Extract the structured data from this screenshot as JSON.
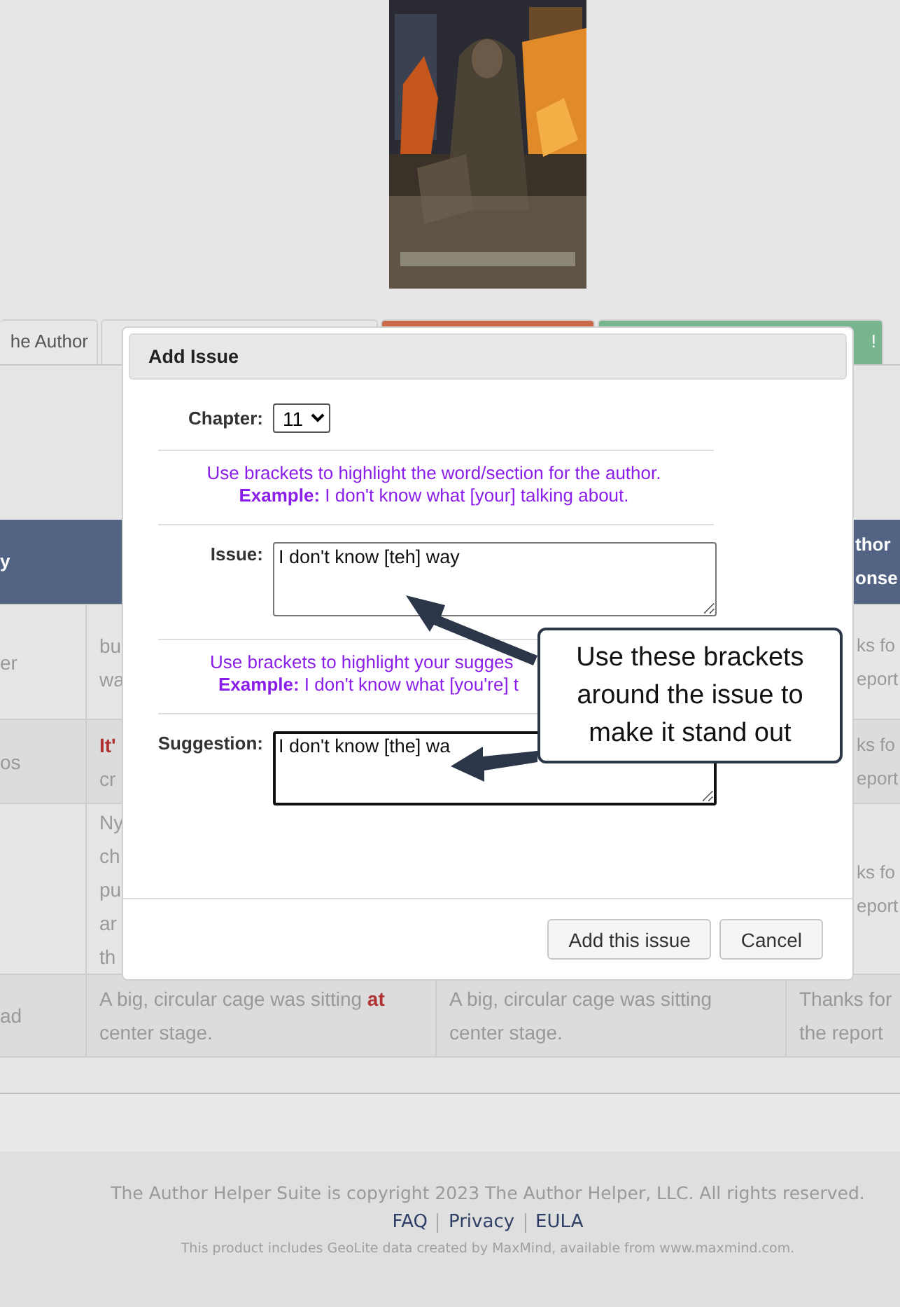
{
  "tabs": [
    {
      "label": "he Author",
      "color": "#e8e8e8"
    },
    {
      "color": "#e8e8e8"
    },
    {
      "color": "#c8694a"
    },
    {
      "label": "!",
      "color": "#76b58d"
    }
  ],
  "table": {
    "columns": [
      {
        "label": "y"
      },
      {},
      {},
      {
        "label": "thor onse"
      }
    ],
    "rows": [
      {
        "cells": [
          [
            "er"
          ],
          [
            "bu",
            "wa"
          ],
          [],
          [
            "ks fo",
            "eport"
          ]
        ]
      },
      {
        "cells": [
          [
            "os"
          ],
          [
            "**It'**",
            "cr"
          ],
          [],
          [
            "ks fo",
            "eport"
          ]
        ]
      },
      {
        "cells": [
          [],
          [
            "Ny",
            "ch",
            "pu",
            "ar",
            "th"
          ],
          [],
          [
            "ks fo",
            "eport"
          ]
        ]
      },
      {
        "cells": [
          [
            "ad"
          ],
          [
            "A big, circular cage was sitting **at** center stage."
          ],
          [
            "A big, circular cage was sitting center stage."
          ],
          [
            "Thanks for",
            "the report"
          ]
        ]
      }
    ]
  },
  "dialog": {
    "title": "Add Issue",
    "chapter": {
      "label": "Chapter:",
      "value": "11"
    },
    "hint_1": [
      "Use brackets to highlight the word/section for the author.",
      "**Example:** I don't know what [your] talking about."
    ],
    "issue": {
      "label": "Issue:",
      "value": "I don't know [teh] way"
    },
    "hint_2": [
      "Use brackets to highlight your sugges",
      "**Example:** I don't know what [you're] t"
    ],
    "suggestion": {
      "label": "Suggestion:",
      "value": "I don't know [the] wa"
    },
    "buttons": [
      "Add this issue",
      "Cancel"
    ]
  },
  "callout": {
    "text": "Use these brackets around the issue to make it stand out"
  },
  "footer": {
    "copyright": "The Author Helper Suite is copyright 2023 The Author Helper, LLC. All rights reserved.",
    "links": [
      "FAQ",
      "Privacy",
      "EULA"
    ],
    "notice": "This product includes GeoLite data created by MaxMind, available from www.maxmind.com."
  }
}
